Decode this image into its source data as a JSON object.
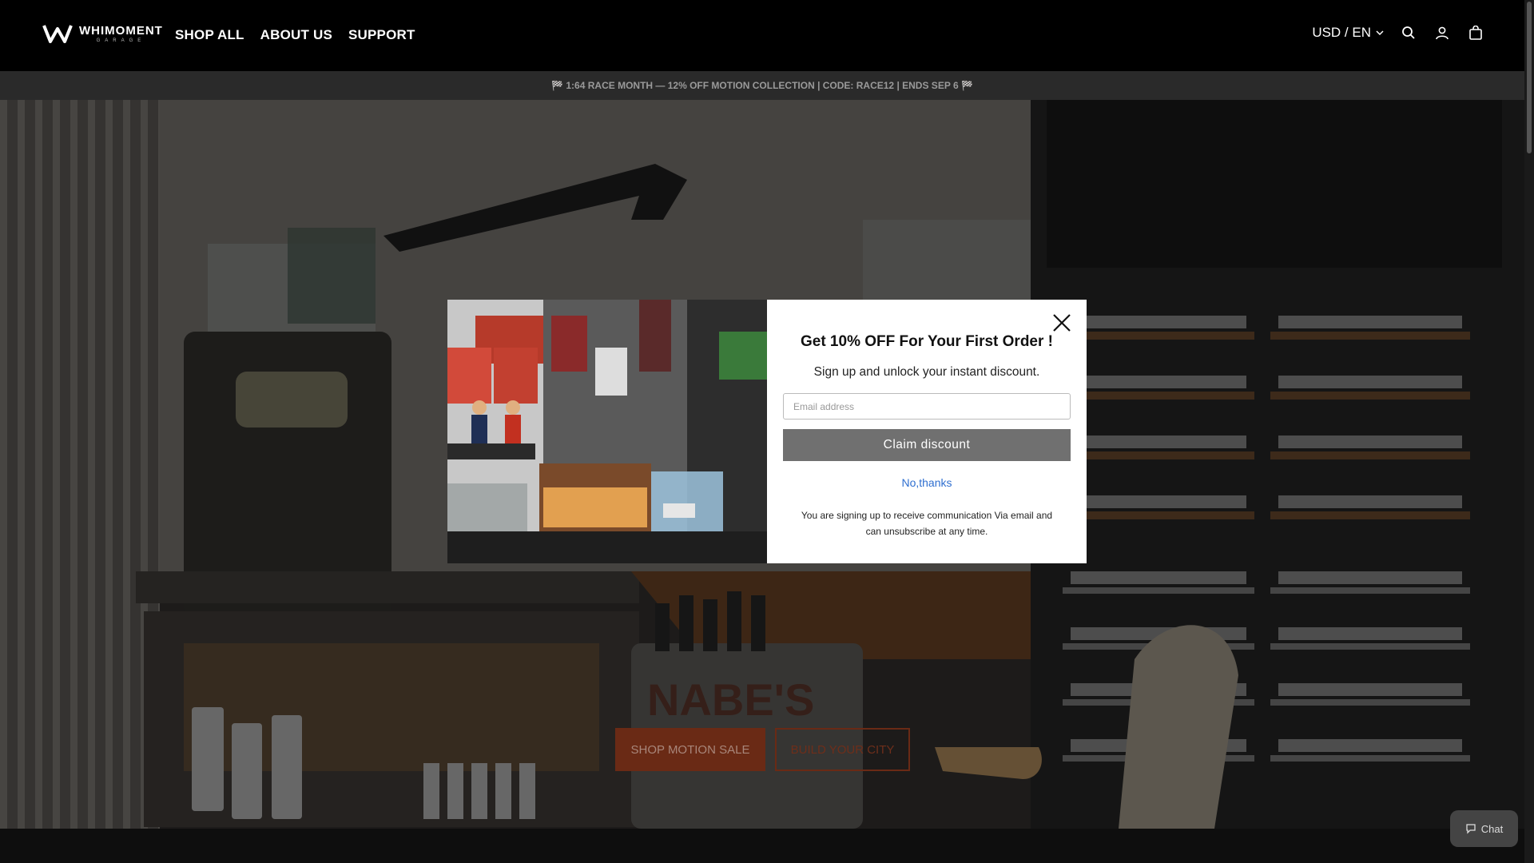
{
  "header": {
    "logo_word": "WHIMOMENT",
    "logo_sub": "GARAGE",
    "nav": [
      "SHOP ALL",
      "ABOUT US",
      "SUPPORT"
    ],
    "locale": "USD / EN",
    "icons": [
      "search-icon",
      "account-icon",
      "cart-icon"
    ]
  },
  "announcement": "🏁 1:64 RACE MONTH — 12% OFF MOTION COLLECTION | CODE: RACE12 | ENDS SEP 6 🏁",
  "hero": {
    "primary_button": "SHOP MOTION SALE",
    "secondary_button": "BUILD YOUR CITY",
    "sign_text": "NABE'S"
  },
  "modal": {
    "title": "Get 10% OFF For Your First Order !",
    "subtitle": "Sign up and unlock your instant discount.",
    "email_placeholder": "Email address",
    "claim_label": "Claim discount",
    "decline_label": "No,thanks",
    "legal": "You are signing up to receive communication Via email and can unsubscribe at any time."
  },
  "chat": {
    "label": "Chat"
  },
  "colors": {
    "header_bg": "#000000",
    "accent": "#6a2a15",
    "claim_button": "#707070",
    "link": "#2f6fd0"
  }
}
